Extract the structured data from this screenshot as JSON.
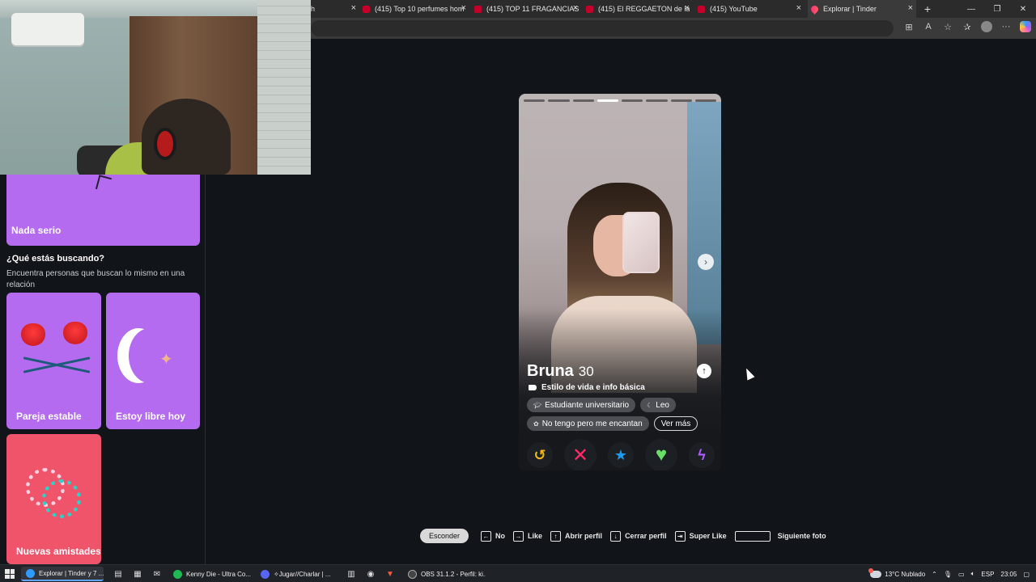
{
  "browser": {
    "tabs": [
      {
        "label": "h",
        "kind": "yt"
      },
      {
        "label": "(415) Top 10 perfumes hom",
        "kind": "yt"
      },
      {
        "label": "(415) TOP 11 FRAGANCIAS",
        "kind": "yt"
      },
      {
        "label": "(415) El REGGAETON de la",
        "kind": "yt"
      },
      {
        "label": "(415) YouTube",
        "kind": "yt"
      },
      {
        "label": "Explorar | Tinder",
        "kind": "tinder",
        "active": true
      }
    ],
    "new_tab_icon": "plus-icon",
    "window_controls": [
      "minimize-icon",
      "restore-icon",
      "close-icon"
    ],
    "toolbar_icons": [
      "app-available-icon",
      "read-aloud-icon",
      "favorite-star-icon",
      "favorites-icon",
      "profile-avatar",
      "more-icon",
      "copilot-icon"
    ]
  },
  "left_panel": {
    "top_card_label": "Nada serio",
    "question_title": "¿Qué estás buscando?",
    "question_subtitle": "Encuentra personas que buscan lo mismo en una relación",
    "options": [
      {
        "label": "Pareja estable",
        "color": "#b56bf0",
        "icon": "roses-icon"
      },
      {
        "label": "Estoy libre hoy",
        "color": "#b56bf0",
        "icon": "moon-icon"
      },
      {
        "label": "Nuevas amistades",
        "color": "#f0546a",
        "icon": "friendship-bracelets-icon"
      }
    ]
  },
  "profile": {
    "name": "Bruna",
    "age": "30",
    "photo_count": 8,
    "current_photo": 4,
    "section_label": "Estilo de vida e info básica",
    "chips": [
      {
        "label": "Estudiante universitario",
        "icon": "graduation-cap-icon"
      },
      {
        "label": "Leo",
        "icon": "moon-icon"
      },
      {
        "label": "No tengo pero me encantan",
        "icon": "paw-icon"
      }
    ],
    "more_label": "Ver más",
    "actions": [
      {
        "name": "rewind-button",
        "icon": "rewind-icon",
        "glyph": "↺"
      },
      {
        "name": "nope-button",
        "icon": "x-icon",
        "glyph": "✕"
      },
      {
        "name": "super-like-button",
        "icon": "star-icon",
        "glyph": "★"
      },
      {
        "name": "like-button",
        "icon": "heart-icon",
        "glyph": "♥"
      },
      {
        "name": "boost-button",
        "icon": "bolt-icon",
        "glyph": "ϟ"
      }
    ]
  },
  "hints": {
    "hide_label": "Esconder",
    "items": [
      {
        "key": "←",
        "label": "No"
      },
      {
        "key": "→",
        "label": "Like"
      },
      {
        "key": "↑",
        "label": "Abrir perfil"
      },
      {
        "key": "↓",
        "label": "Cerrar perfil"
      },
      {
        "key": "⇥",
        "label": "Super Like"
      },
      {
        "key": "",
        "label": "Siguiente foto",
        "wide": true
      }
    ]
  },
  "taskbar": {
    "apps": [
      {
        "label": "Explorar | Tinder y 7 ...",
        "color": "#2f9bff",
        "active": true
      },
      {
        "label": "Kenny Die - Ultra Co...",
        "color": "#1db954"
      },
      {
        "label": "✧Jugar//Charlar | ...",
        "color": "#5865f2"
      },
      {
        "label": "OBS 31.1.2 - Perfil: ki...",
        "color": "#444"
      }
    ],
    "weather": "13°C  Nublado",
    "language": "ESP",
    "time": "23:05"
  }
}
